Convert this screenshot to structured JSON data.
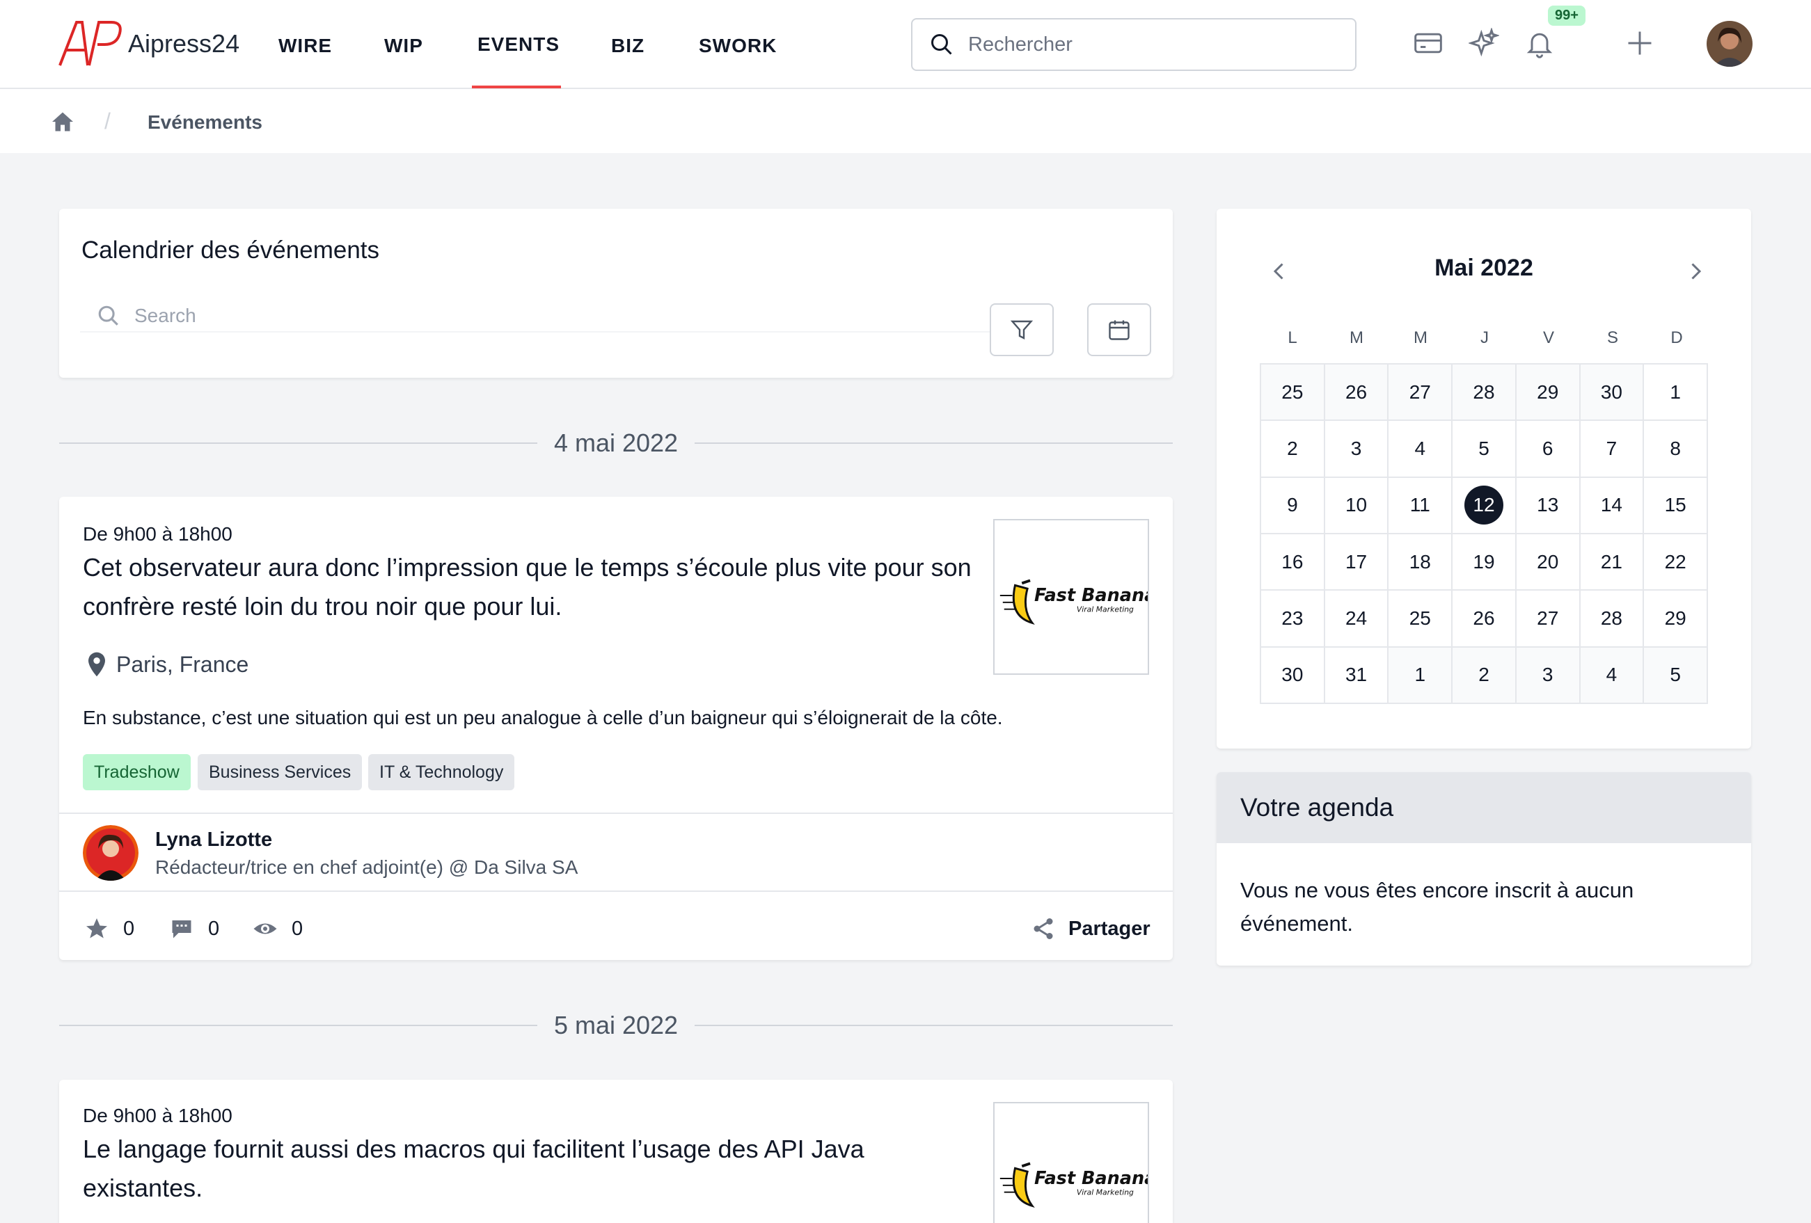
{
  "header": {
    "logo_mark": "AP",
    "logo_text": "Aipress24",
    "nav": [
      "WIRE",
      "WIP",
      "EVENTS",
      "BIZ",
      "SWORK"
    ],
    "active_nav": "EVENTS",
    "search_placeholder": "Rechercher",
    "notification_badge": "99+",
    "icons": [
      "card-icon",
      "sparkles-icon",
      "bell-icon",
      "plus-icon"
    ],
    "accent_color": "#ef4444"
  },
  "breadcrumb": {
    "current": "Evénements"
  },
  "calendar_panel": {
    "title": "Calendrier des événements",
    "search_placeholder": "Search"
  },
  "events": [
    {
      "date_label": "4 mai 2022",
      "time": "De 9h00 à 18h00",
      "title": "Cet observateur aura donc l’impression que le temps s’écoule plus vite pour son confrère resté loin du trou noir que pour lui.",
      "location": "Paris, France",
      "description": "En substance, c’est une situation qui est un peu analogue à celle d’un baigneur qui s’éloignerait de la côte.",
      "tags": [
        "Tradeshow",
        "Business Services",
        "IT & Technology"
      ],
      "logo": {
        "name": "Fast Banana",
        "tagline": "Viral Marketing"
      },
      "author": {
        "name": "Lyna Lizotte",
        "role": "Rédacteur/trice en chef adjoint(e) @ Da Silva SA"
      },
      "stats": {
        "stars": "0",
        "comments": "0",
        "views": "0"
      },
      "share_label": "Partager"
    },
    {
      "date_label": "5 mai 2022",
      "time": "De 9h00 à 18h00",
      "title": "Le langage fournit aussi des macros qui facilitent l’usage des API Java existantes.",
      "logo": {
        "name": "Fast Banana",
        "tagline": "Viral Marketing"
      }
    }
  ],
  "mini_calendar": {
    "month_label": "Mai 2022",
    "weekdays": [
      "L",
      "M",
      "M",
      "J",
      "V",
      "S",
      "D"
    ],
    "days": [
      [
        "25",
        "26",
        "27",
        "28",
        "29",
        "30",
        "1"
      ],
      [
        "2",
        "3",
        "4",
        "5",
        "6",
        "7",
        "8"
      ],
      [
        "9",
        "10",
        "11",
        "12",
        "13",
        "14",
        "15"
      ],
      [
        "16",
        "17",
        "18",
        "19",
        "20",
        "21",
        "22"
      ],
      [
        "23",
        "24",
        "25",
        "26",
        "27",
        "28",
        "29"
      ],
      [
        "30",
        "31",
        "1",
        "2",
        "3",
        "4",
        "5"
      ]
    ],
    "selected_day": "12"
  },
  "agenda": {
    "title": "Votre agenda",
    "empty_text": "Vous ne vous êtes encore inscrit à aucun événement."
  }
}
